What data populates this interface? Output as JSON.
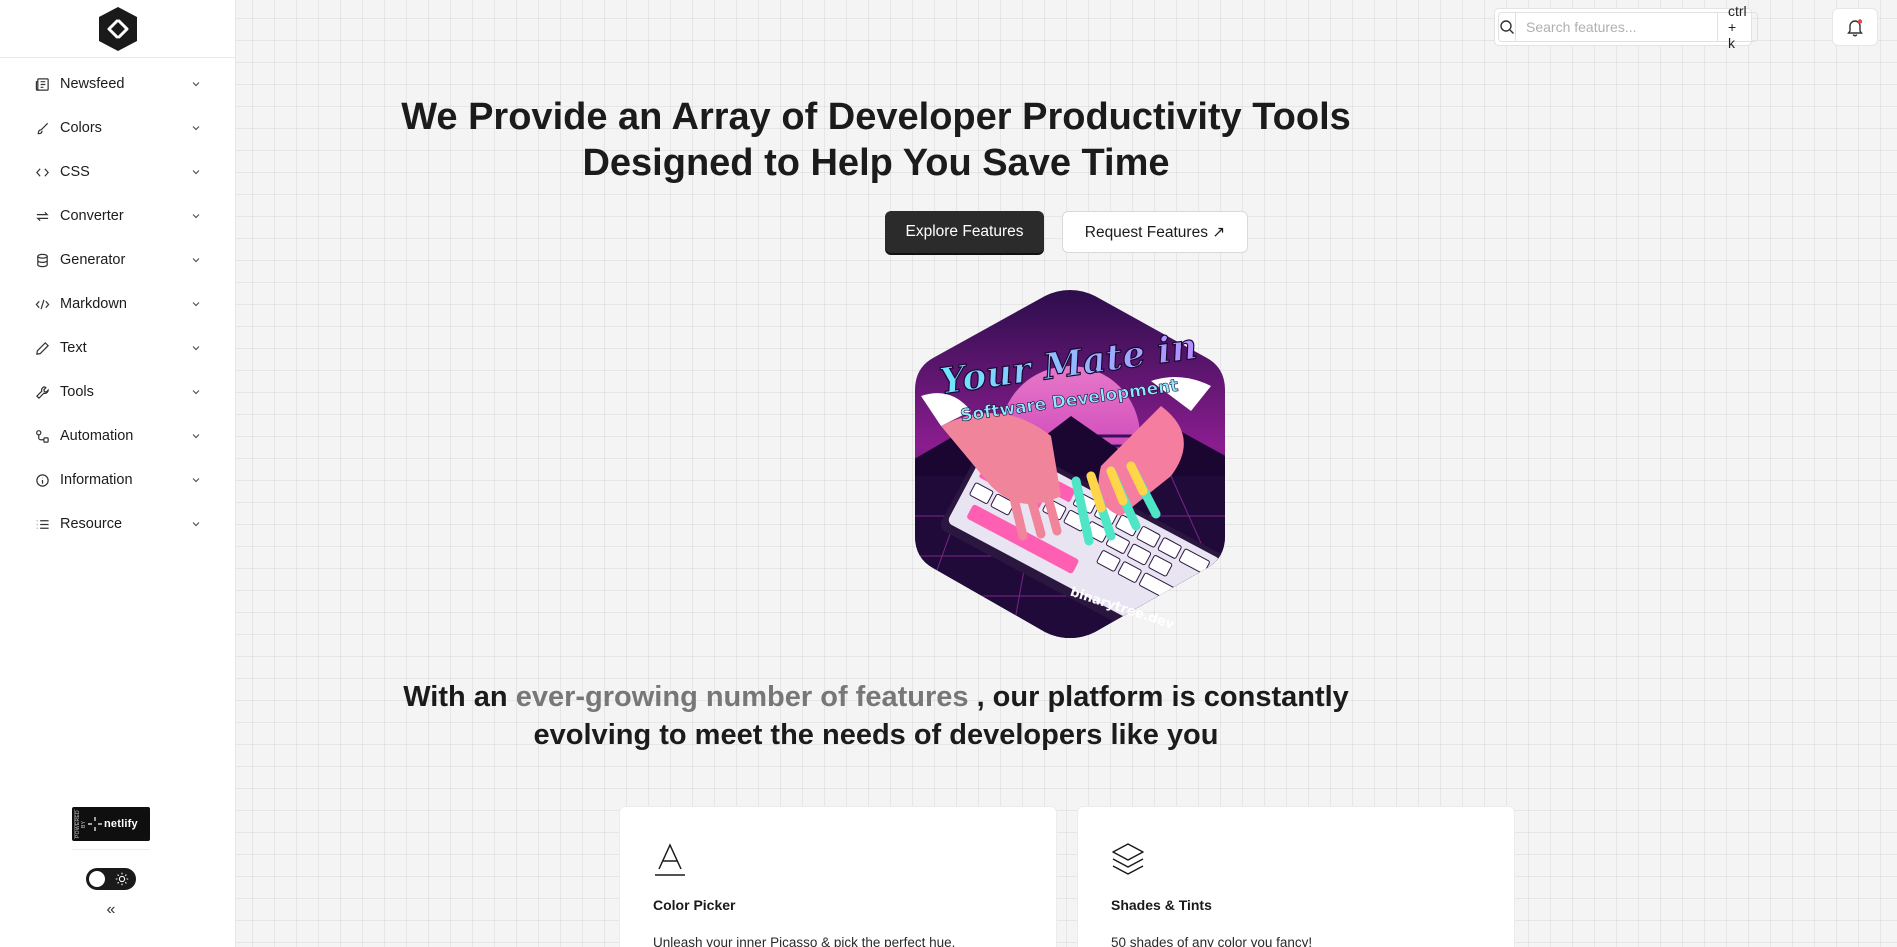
{
  "sidebar": {
    "items": [
      {
        "label": "Newsfeed",
        "icon": "newspaper-icon"
      },
      {
        "label": "Colors",
        "icon": "brush-icon"
      },
      {
        "label": "CSS",
        "icon": "code-brackets-icon"
      },
      {
        "label": "Converter",
        "icon": "arrows-repeat-icon"
      },
      {
        "label": "Generator",
        "icon": "database-icon"
      },
      {
        "label": "Markdown",
        "icon": "code-slash-icon"
      },
      {
        "label": "Text",
        "icon": "pencil-icon"
      },
      {
        "label": "Tools",
        "icon": "wrench-icon"
      },
      {
        "label": "Automation",
        "icon": "workflow-icon"
      },
      {
        "label": "Information",
        "icon": "info-circle-icon"
      },
      {
        "label": "Resource",
        "icon": "list-icon"
      }
    ],
    "netlify_side_text": "POWERED BY",
    "netlify_brand": "netlify",
    "collapse_label": "«"
  },
  "header": {
    "search_placeholder": "Search features...",
    "search_shortcut": "ctrl + k"
  },
  "hero": {
    "title": "We Provide an Array of Developer Productivity Tools Designed to Help You Save Time",
    "primary_button": "Explore Features",
    "secondary_button": "Request Features ↗",
    "art_line1": "Your Mate in",
    "art_line2": "Software Development",
    "art_footer": "binarytree.dev"
  },
  "subtitle": {
    "prefix": "With an ",
    "highlight": "ever-growing number of features",
    "suffix": " , our platform is constantly evolving to meet the needs of developers like you"
  },
  "cards": [
    {
      "title": "Color Picker",
      "description": "Unleash your inner Picasso & pick the perfect hue.",
      "icon": "letter-a-icon"
    },
    {
      "title": "Shades & Tints",
      "description": "50 shades of any color you fancy!",
      "icon": "layers-icon"
    }
  ],
  "colors": {
    "accent_dark": "#2b2b2b",
    "notification_dot": "#e5484d",
    "muted_text": "#777777"
  }
}
